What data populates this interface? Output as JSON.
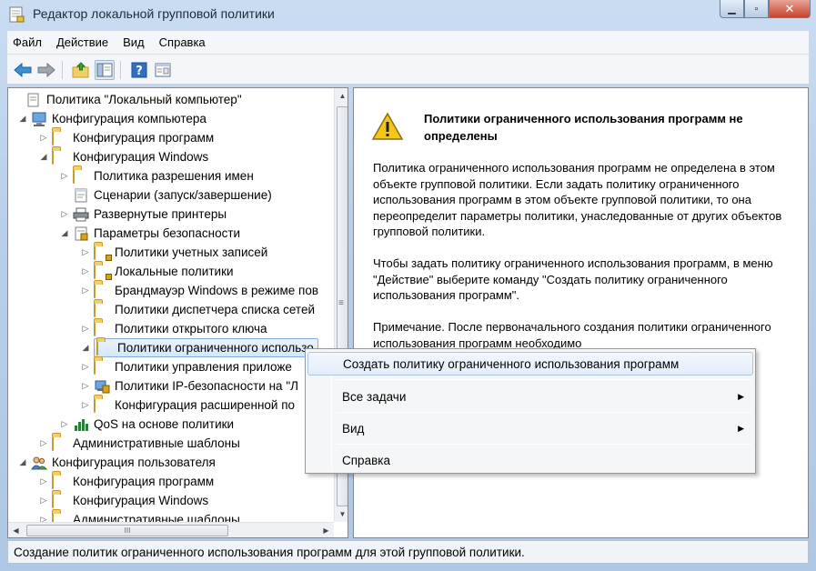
{
  "window": {
    "title": "Редактор локальной групповой политики",
    "caption_buttons": {
      "minimize": "▁",
      "maximize": "▫",
      "close": "✕"
    }
  },
  "menubar": {
    "items": [
      "Файл",
      "Действие",
      "Вид",
      "Справка"
    ]
  },
  "toolbar": {
    "buttons": [
      "back-icon",
      "forward-icon",
      "up-folder-icon",
      "show-hide-tree-icon",
      "help-icon",
      "properties-icon"
    ]
  },
  "tree": {
    "items": [
      {
        "label": "Политика \"Локальный компьютер\"",
        "icon": "policy-doc-icon",
        "expander": ""
      },
      {
        "label": "Конфигурация компьютера",
        "icon": "computer-icon",
        "expander": "◢"
      },
      {
        "label": "Конфигурация программ",
        "icon": "folder-icon",
        "expander": "▷"
      },
      {
        "label": "Конфигурация Windows",
        "icon": "folder-icon",
        "expander": "◢"
      },
      {
        "label": "Политика разрешения имен",
        "icon": "folder-icon",
        "expander": "▷"
      },
      {
        "label": "Сценарии (запуск/завершение)",
        "icon": "script-icon",
        "expander": ""
      },
      {
        "label": "Развернутые принтеры",
        "icon": "printer-icon",
        "expander": "▷"
      },
      {
        "label": "Параметры безопасности",
        "icon": "security-settings-icon",
        "expander": "◢"
      },
      {
        "label": "Политики учетных записей",
        "icon": "locked-folder-icon",
        "expander": "▷"
      },
      {
        "label": "Локальные политики",
        "icon": "locked-folder-icon",
        "expander": "▷"
      },
      {
        "label": "Брандмауэр Windows в режиме пов",
        "icon": "folder-icon",
        "expander": "▷"
      },
      {
        "label": "Политики диспетчера списка сетей",
        "icon": "folder-icon",
        "expander": ""
      },
      {
        "label": "Политики открытого ключа",
        "icon": "folder-icon",
        "expander": "▷"
      },
      {
        "label": "Политики ограниченного использо",
        "icon": "folder-icon",
        "expander": "◢"
      },
      {
        "label": "Политики управления приложе",
        "icon": "folder-icon",
        "expander": "▷"
      },
      {
        "label": "Политики IP-безопасности на \"Л",
        "icon": "ip-security-icon",
        "expander": "▷"
      },
      {
        "label": "Конфигурация расширенной по",
        "icon": "folder-icon",
        "expander": "▷"
      },
      {
        "label": "QoS на основе политики",
        "icon": "chart-icon",
        "expander": "▷"
      },
      {
        "label": "Административные шаблоны",
        "icon": "folder-icon",
        "expander": "▷"
      },
      {
        "label": "Конфигурация пользователя",
        "icon": "users-icon",
        "expander": "◢"
      },
      {
        "label": "Конфигурация программ",
        "icon": "folder-icon",
        "expander": "▷"
      },
      {
        "label": "Конфигурация Windows",
        "icon": "folder-icon",
        "expander": "▷"
      },
      {
        "label": "Административные шаблоны",
        "icon": "folder-icon",
        "expander": "▷"
      }
    ],
    "selected_index": 13
  },
  "details": {
    "heading": "Политики ограниченного использования программ не определены",
    "para1": "Политика ограниченного использования программ не определена в этом объекте групповой политики. Если задать политику ограниченного использования программ в этом объекте групповой политики, то она переопределит параметры политики, унаследованные от других объектов групповой политики.",
    "para2": "Чтобы задать политику ограниченного использования программ, в меню \"Действие\" выберите команду \"Создать политику ограниченного использования программ\".",
    "para3": "Примечание. После первоначального создания политики ограниченного использования программ необходимо"
  },
  "context_menu": {
    "items": [
      {
        "label": "Создать политику ограниченного использования программ",
        "submenu": false
      },
      {
        "label": "Все задачи",
        "submenu": true
      },
      {
        "label": "Вид",
        "submenu": true
      },
      {
        "label": "Справка",
        "submenu": false
      }
    ],
    "submenu_glyph": "▶"
  },
  "scrollbars": {
    "left_h_grip": "III",
    "left_v_grip": "≡"
  },
  "statusbar": {
    "text": "Создание политик ограниченного использования программ для этой групповой политики."
  },
  "colors": {
    "warning_yellow": "#f5c518",
    "selection_border": "#84acdd",
    "window_frame": "#b8cfe9"
  }
}
